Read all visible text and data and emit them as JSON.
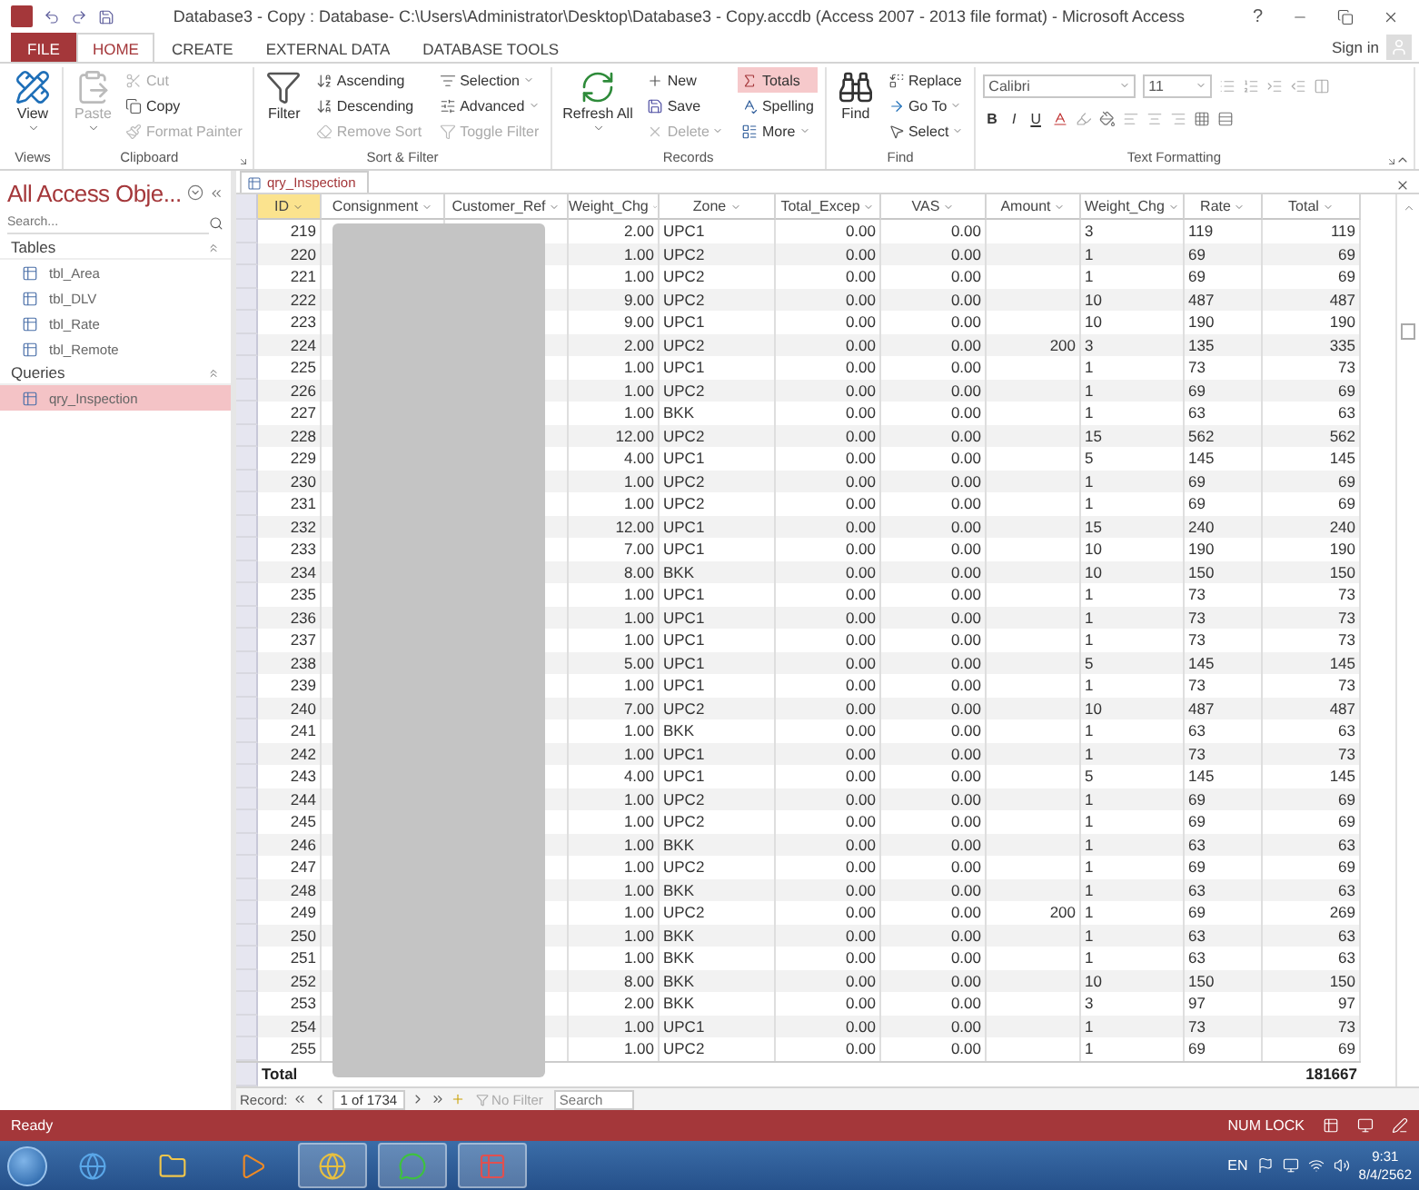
{
  "window": {
    "title": "Database3 - Copy : Database- C:\\Users\\Administrator\\Desktop\\Database3 - Copy.accdb (Access 2007 - 2013 file format) - Microsoft Access",
    "help": "?",
    "sign_in": "Sign in"
  },
  "ribbon_tabs": [
    {
      "label": "FILE",
      "kind": "file",
      "selected": false
    },
    {
      "label": "HOME",
      "kind": "tab",
      "selected": true
    },
    {
      "label": "CREATE",
      "kind": "tab",
      "selected": false
    },
    {
      "label": "EXTERNAL DATA",
      "kind": "tab",
      "selected": false
    },
    {
      "label": "DATABASE TOOLS",
      "kind": "tab",
      "selected": false
    }
  ],
  "ribbon_groups": [
    {
      "label": "Views",
      "launcher": false,
      "items": [
        {
          "label": "View",
          "kind": "large",
          "disabled": false,
          "on": false,
          "dropdown": true
        }
      ]
    },
    {
      "label": "Clipboard",
      "launcher": true,
      "items": [
        {
          "label": "Paste",
          "kind": "large",
          "disabled": true,
          "on": false,
          "dropdown": true
        },
        {
          "label": "Cut",
          "kind": "small",
          "disabled": true,
          "on": false,
          "dropdown": false
        },
        {
          "label": "Copy",
          "kind": "small",
          "disabled": false,
          "on": false,
          "dropdown": false
        },
        {
          "label": "Format Painter",
          "kind": "small",
          "disabled": true,
          "on": false,
          "dropdown": false
        }
      ]
    },
    {
      "label": "Sort & Filter",
      "launcher": false,
      "items": [
        {
          "label": "Filter",
          "kind": "large",
          "disabled": false,
          "on": false,
          "dropdown": false
        },
        {
          "label": "Ascending",
          "kind": "small",
          "disabled": false,
          "on": false,
          "dropdown": false
        },
        {
          "label": "Descending",
          "kind": "small",
          "disabled": false,
          "on": false,
          "dropdown": false
        },
        {
          "label": "Remove Sort",
          "kind": "small",
          "disabled": true,
          "on": false,
          "dropdown": false
        },
        {
          "label": "Selection",
          "kind": "small",
          "disabled": false,
          "on": false,
          "dropdown": true
        },
        {
          "label": "Advanced",
          "kind": "small",
          "disabled": false,
          "on": false,
          "dropdown": true
        },
        {
          "label": "Toggle Filter",
          "kind": "small",
          "disabled": true,
          "on": false,
          "dropdown": false
        }
      ]
    },
    {
      "label": "Records",
      "launcher": false,
      "items": [
        {
          "label": "Refresh All",
          "kind": "large",
          "disabled": false,
          "on": false,
          "dropdown": true
        },
        {
          "label": "New",
          "kind": "small",
          "disabled": false,
          "on": false,
          "dropdown": false
        },
        {
          "label": "Save",
          "kind": "small",
          "disabled": false,
          "on": false,
          "dropdown": false
        },
        {
          "label": "Delete",
          "kind": "small",
          "disabled": true,
          "on": false,
          "dropdown": true
        },
        {
          "label": "Totals",
          "kind": "small",
          "disabled": false,
          "on": true,
          "dropdown": false
        },
        {
          "label": "Spelling",
          "kind": "small",
          "disabled": false,
          "on": false,
          "dropdown": false
        },
        {
          "label": "More",
          "kind": "small",
          "disabled": false,
          "on": false,
          "dropdown": true
        }
      ]
    },
    {
      "label": "Find",
      "launcher": false,
      "items": [
        {
          "label": "Find",
          "kind": "large",
          "disabled": false,
          "on": false,
          "dropdown": false
        },
        {
          "label": "Replace",
          "kind": "small",
          "disabled": false,
          "on": false,
          "dropdown": false
        },
        {
          "label": "Go To",
          "kind": "small",
          "disabled": false,
          "on": false,
          "dropdown": true
        },
        {
          "label": "Select",
          "kind": "small",
          "disabled": false,
          "on": false,
          "dropdown": true
        }
      ]
    }
  ],
  "text_formatting": {
    "label": "Text Formatting",
    "launcher": true,
    "font": "Calibri",
    "size": "11",
    "styles": [
      "B",
      "I",
      "U"
    ]
  },
  "nav_pane": {
    "title": "All Access Obje...",
    "search_placeholder": "Search...",
    "sections": [
      {
        "label": "Tables",
        "items": [
          {
            "label": "tbl_Area",
            "selected": false
          },
          {
            "label": "tbl_DLV",
            "selected": false
          },
          {
            "label": "tbl_Rate",
            "selected": false
          },
          {
            "label": "tbl_Remote",
            "selected": false
          }
        ]
      },
      {
        "label": "Queries",
        "items": [
          {
            "label": "qry_Inspection",
            "selected": true
          }
        ]
      }
    ]
  },
  "document_tab": {
    "label": "qry_Inspection"
  },
  "table": {
    "columns": [
      {
        "label": "ID",
        "selected": true
      },
      {
        "label": "Consignment",
        "selected": false
      },
      {
        "label": "Customer_Ref",
        "selected": false
      },
      {
        "label": "Weight_Chg",
        "selected": false
      },
      {
        "label": "Zone",
        "selected": false
      },
      {
        "label": "Total_Excep",
        "selected": false
      },
      {
        "label": "VAS",
        "selected": false
      },
      {
        "label": "Amount",
        "selected": false
      },
      {
        "label": "Weight_Chg",
        "selected": false
      },
      {
        "label": "Rate",
        "selected": false
      },
      {
        "label": "Total",
        "selected": false
      }
    ],
    "rows": [
      {
        "id": "219",
        "weight_chg": "2.00",
        "zone": "UPC1",
        "total_excep": "0.00",
        "vas": "0.00",
        "weight_chg_2": "3",
        "rate": "119",
        "total": "119"
      },
      {
        "id": "220",
        "weight_chg": "1.00",
        "zone": "UPC2",
        "total_excep": "0.00",
        "vas": "0.00",
        "weight_chg_2": "1",
        "rate": "69",
        "total": "69"
      },
      {
        "id": "221",
        "weight_chg": "1.00",
        "zone": "UPC2",
        "total_excep": "0.00",
        "vas": "0.00",
        "weight_chg_2": "1",
        "rate": "69",
        "total": "69"
      },
      {
        "id": "222",
        "weight_chg": "9.00",
        "zone": "UPC2",
        "total_excep": "0.00",
        "vas": "0.00",
        "weight_chg_2": "10",
        "rate": "487",
        "total": "487"
      },
      {
        "id": "223",
        "weight_chg": "9.00",
        "zone": "UPC1",
        "total_excep": "0.00",
        "vas": "0.00",
        "weight_chg_2": "10",
        "rate": "190",
        "total": "190"
      },
      {
        "id": "224",
        "weight_chg": "2.00",
        "zone": "UPC2",
        "total_excep": "0.00",
        "vas": "0.00",
        "amount": "200",
        "weight_chg_2": "3",
        "rate": "135",
        "total": "335"
      },
      {
        "id": "225",
        "weight_chg": "1.00",
        "zone": "UPC1",
        "total_excep": "0.00",
        "vas": "0.00",
        "weight_chg_2": "1",
        "rate": "73",
        "total": "73"
      },
      {
        "id": "226",
        "weight_chg": "1.00",
        "zone": "UPC2",
        "total_excep": "0.00",
        "vas": "0.00",
        "weight_chg_2": "1",
        "rate": "69",
        "total": "69"
      },
      {
        "id": "227",
        "weight_chg": "1.00",
        "zone": "BKK",
        "total_excep": "0.00",
        "vas": "0.00",
        "weight_chg_2": "1",
        "rate": "63",
        "total": "63"
      },
      {
        "id": "228",
        "weight_chg": "12.00",
        "zone": "UPC2",
        "total_excep": "0.00",
        "vas": "0.00",
        "weight_chg_2": "15",
        "rate": "562",
        "total": "562"
      },
      {
        "id": "229",
        "weight_chg": "4.00",
        "zone": "UPC1",
        "total_excep": "0.00",
        "vas": "0.00",
        "weight_chg_2": "5",
        "rate": "145",
        "total": "145"
      },
      {
        "id": "230",
        "weight_chg": "1.00",
        "zone": "UPC2",
        "total_excep": "0.00",
        "vas": "0.00",
        "weight_chg_2": "1",
        "rate": "69",
        "total": "69"
      },
      {
        "id": "231",
        "weight_chg": "1.00",
        "zone": "UPC2",
        "total_excep": "0.00",
        "vas": "0.00",
        "weight_chg_2": "1",
        "rate": "69",
        "total": "69"
      },
      {
        "id": "232",
        "weight_chg": "12.00",
        "zone": "UPC1",
        "total_excep": "0.00",
        "vas": "0.00",
        "weight_chg_2": "15",
        "rate": "240",
        "total": "240"
      },
      {
        "id": "233",
        "weight_chg": "7.00",
        "zone": "UPC1",
        "total_excep": "0.00",
        "vas": "0.00",
        "weight_chg_2": "10",
        "rate": "190",
        "total": "190"
      },
      {
        "id": "234",
        "weight_chg": "8.00",
        "zone": "BKK",
        "total_excep": "0.00",
        "vas": "0.00",
        "weight_chg_2": "10",
        "rate": "150",
        "total": "150"
      },
      {
        "id": "235",
        "weight_chg": "1.00",
        "zone": "UPC1",
        "total_excep": "0.00",
        "vas": "0.00",
        "weight_chg_2": "1",
        "rate": "73",
        "total": "73"
      },
      {
        "id": "236",
        "weight_chg": "1.00",
        "zone": "UPC1",
        "total_excep": "0.00",
        "vas": "0.00",
        "weight_chg_2": "1",
        "rate": "73",
        "total": "73"
      },
      {
        "id": "237",
        "weight_chg": "1.00",
        "zone": "UPC1",
        "total_excep": "0.00",
        "vas": "0.00",
        "weight_chg_2": "1",
        "rate": "73",
        "total": "73"
      },
      {
        "id": "238",
        "weight_chg": "5.00",
        "zone": "UPC1",
        "total_excep": "0.00",
        "vas": "0.00",
        "weight_chg_2": "5",
        "rate": "145",
        "total": "145"
      },
      {
        "id": "239",
        "weight_chg": "1.00",
        "zone": "UPC1",
        "total_excep": "0.00",
        "vas": "0.00",
        "weight_chg_2": "1",
        "rate": "73",
        "total": "73"
      },
      {
        "id": "240",
        "weight_chg": "7.00",
        "zone": "UPC2",
        "total_excep": "0.00",
        "vas": "0.00",
        "weight_chg_2": "10",
        "rate": "487",
        "total": "487"
      },
      {
        "id": "241",
        "weight_chg": "1.00",
        "zone": "BKK",
        "total_excep": "0.00",
        "vas": "0.00",
        "weight_chg_2": "1",
        "rate": "63",
        "total": "63"
      },
      {
        "id": "242",
        "weight_chg": "1.00",
        "zone": "UPC1",
        "total_excep": "0.00",
        "vas": "0.00",
        "weight_chg_2": "1",
        "rate": "73",
        "total": "73"
      },
      {
        "id": "243",
        "weight_chg": "4.00",
        "zone": "UPC1",
        "total_excep": "0.00",
        "vas": "0.00",
        "weight_chg_2": "5",
        "rate": "145",
        "total": "145"
      },
      {
        "id": "244",
        "weight_chg": "1.00",
        "zone": "UPC2",
        "total_excep": "0.00",
        "vas": "0.00",
        "weight_chg_2": "1",
        "rate": "69",
        "total": "69"
      },
      {
        "id": "245",
        "weight_chg": "1.00",
        "zone": "UPC2",
        "total_excep": "0.00",
        "vas": "0.00",
        "weight_chg_2": "1",
        "rate": "69",
        "total": "69"
      },
      {
        "id": "246",
        "weight_chg": "1.00",
        "zone": "BKK",
        "total_excep": "0.00",
        "vas": "0.00",
        "weight_chg_2": "1",
        "rate": "63",
        "total": "63"
      },
      {
        "id": "247",
        "weight_chg": "1.00",
        "zone": "UPC2",
        "total_excep": "0.00",
        "vas": "0.00",
        "weight_chg_2": "1",
        "rate": "69",
        "total": "69"
      },
      {
        "id": "248",
        "weight_chg": "1.00",
        "zone": "BKK",
        "total_excep": "0.00",
        "vas": "0.00",
        "weight_chg_2": "1",
        "rate": "63",
        "total": "63"
      },
      {
        "id": "249",
        "weight_chg": "1.00",
        "zone": "UPC2",
        "total_excep": "0.00",
        "vas": "0.00",
        "amount": "200",
        "weight_chg_2": "1",
        "rate": "69",
        "total": "269"
      },
      {
        "id": "250",
        "weight_chg": "1.00",
        "zone": "BKK",
        "total_excep": "0.00",
        "vas": "0.00",
        "weight_chg_2": "1",
        "rate": "63",
        "total": "63"
      },
      {
        "id": "251",
        "weight_chg": "1.00",
        "zone": "BKK",
        "total_excep": "0.00",
        "vas": "0.00",
        "weight_chg_2": "1",
        "rate": "63",
        "total": "63"
      },
      {
        "id": "252",
        "weight_chg": "8.00",
        "zone": "BKK",
        "total_excep": "0.00",
        "vas": "0.00",
        "weight_chg_2": "10",
        "rate": "150",
        "total": "150"
      },
      {
        "id": "253",
        "weight_chg": "2.00",
        "zone": "BKK",
        "total_excep": "0.00",
        "vas": "0.00",
        "weight_chg_2": "3",
        "rate": "97",
        "total": "97"
      },
      {
        "id": "254",
        "weight_chg": "1.00",
        "zone": "UPC1",
        "total_excep": "0.00",
        "vas": "0.00",
        "weight_chg_2": "1",
        "rate": "73",
        "total": "73"
      },
      {
        "id": "255",
        "weight_chg": "1.00",
        "zone": "UPC2",
        "total_excep": "0.00",
        "vas": "0.00",
        "weight_chg_2": "1",
        "rate": "69",
        "total": "69"
      }
    ],
    "totals_row": {
      "label": "Total",
      "total": "181667"
    }
  },
  "record_nav": {
    "label": "Record:",
    "position": "1 of 1734",
    "filter": "No Filter",
    "filter_disabled": true,
    "search_placeholder": "Search"
  },
  "status_bar": {
    "status": "Ready",
    "indicator": "NUM LOCK"
  },
  "taskbar": {
    "apps": [
      {
        "running": false
      },
      {
        "running": false
      },
      {
        "running": false
      },
      {
        "running": true
      },
      {
        "running": true
      },
      {
        "running": true
      }
    ],
    "language": "EN",
    "time": "9:31",
    "date": "8/4/2562"
  }
}
